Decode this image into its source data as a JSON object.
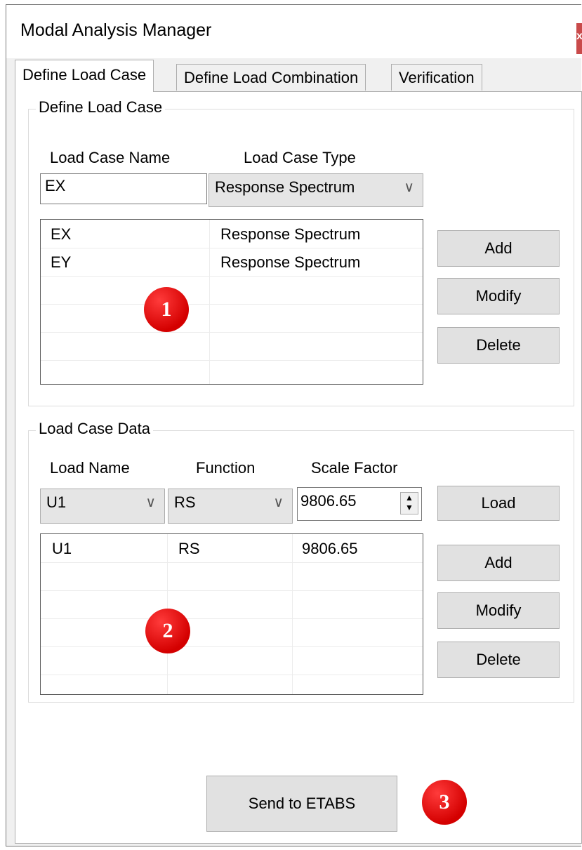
{
  "window": {
    "title": "Modal Analysis Manager",
    "close_label": "x"
  },
  "tabs": [
    "Define Load Case",
    "Define Load Combination",
    "Verification"
  ],
  "define_load_case": {
    "group_title": "Define Load Case",
    "name_label": "Load Case Name",
    "type_label": "Load Case Type",
    "name_value": "EX",
    "type_value": "Response Spectrum",
    "rows": [
      {
        "name": "EX",
        "type": "Response Spectrum"
      },
      {
        "name": "EY",
        "type": "Response Spectrum"
      }
    ],
    "add_label": "Add",
    "modify_label": "Modify",
    "delete_label": "Delete"
  },
  "load_case_data": {
    "group_title": "Load Case Data",
    "load_name_label": "Load Name",
    "function_label": "Function",
    "scale_factor_label": "Scale Factor",
    "load_name_value": "U1",
    "function_value": "RS",
    "scale_factor_value": "9806.65",
    "load_label": "Load",
    "rows": [
      {
        "load_name": "U1",
        "function": "RS",
        "scale_factor": "9806.65"
      }
    ],
    "add_label": "Add",
    "modify_label": "Modify",
    "delete_label": "Delete"
  },
  "send_label": "Send to ETABS",
  "badges": [
    "1",
    "2",
    "3"
  ],
  "colors": {
    "badge": "#d40000",
    "close": "#c94a4a"
  }
}
